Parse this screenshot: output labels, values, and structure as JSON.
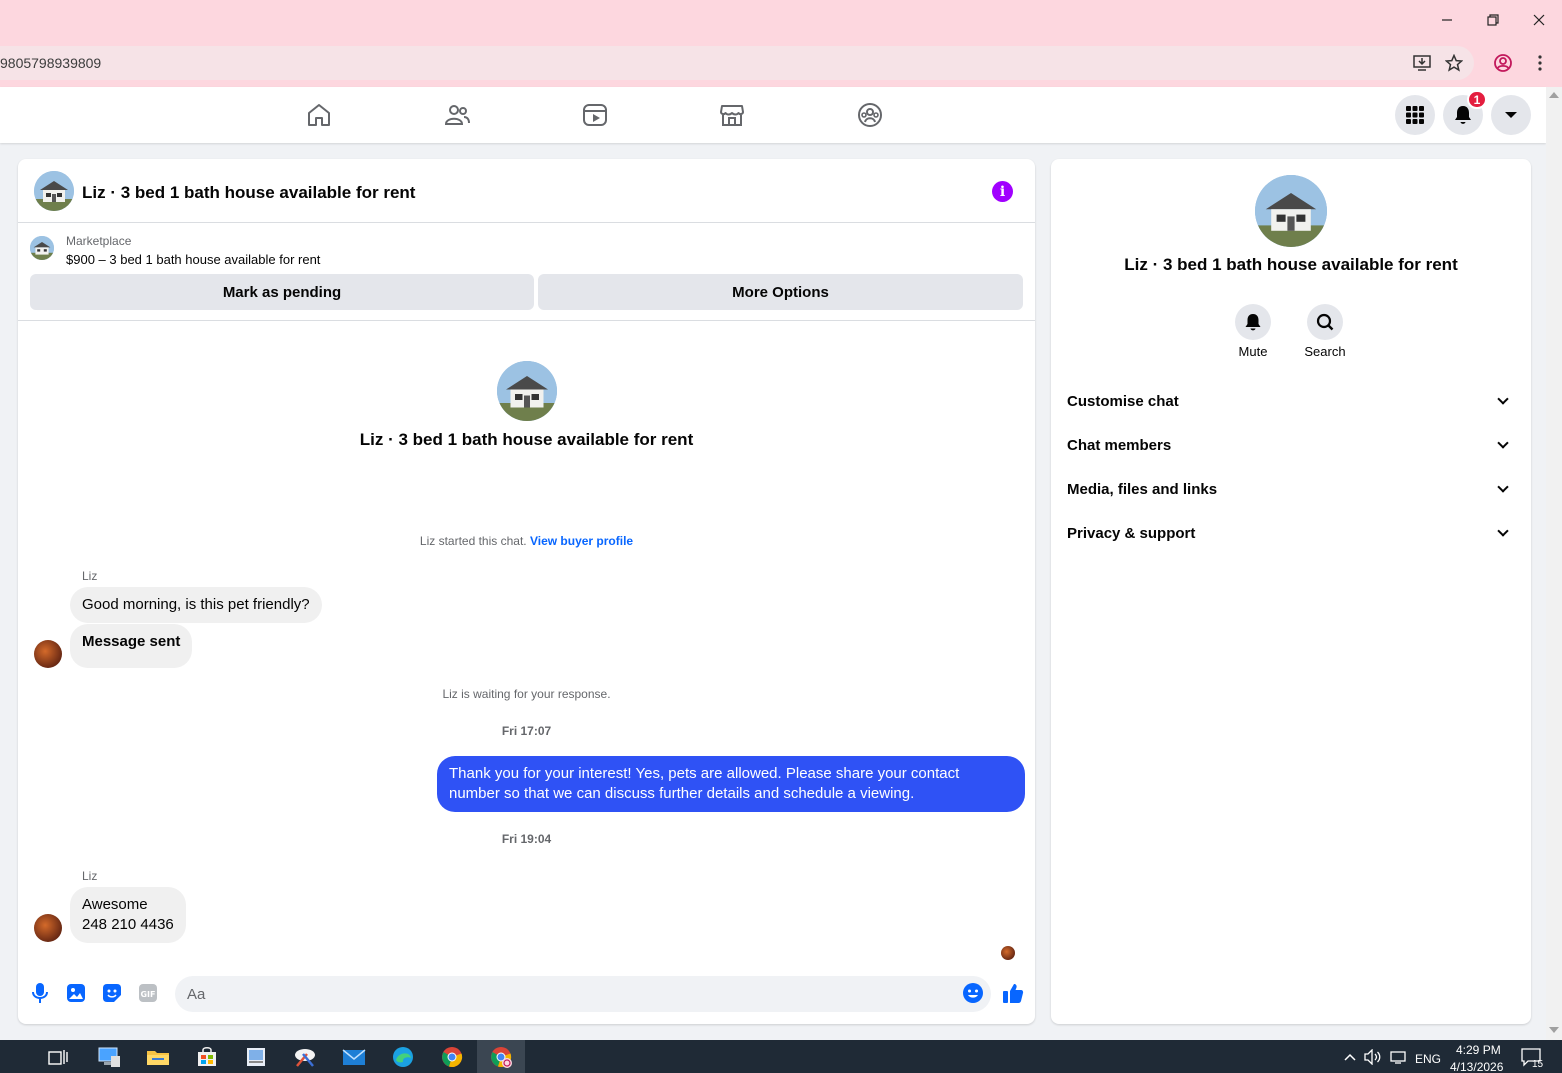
{
  "browser": {
    "url": "9805798939809"
  },
  "nav": {
    "notification_count": "1"
  },
  "chat": {
    "title": "Liz · 3 bed 1 bath house available for rent",
    "marketplace_label": "Marketplace",
    "listing_title": "$900 – 3 bed 1 bath house available for rent",
    "mark_pending_label": "Mark as pending",
    "more_options_label": "More Options",
    "intro_title": "Liz · 3 bed 1 bath house available for rent",
    "started_text": "Liz started this chat.",
    "view_buyer_profile": "View buyer profile",
    "waiting_text": "Liz is waiting for your response.",
    "messages": [
      {
        "sender": "Liz",
        "text": "Good morning, is this pet friendly?"
      },
      {
        "text": "Message sent"
      },
      {
        "time": "Fri 17:07"
      },
      {
        "text": "Thank you for your interest! Yes, pets are allowed. Please share your contact number so that we can discuss further details and schedule a viewing."
      },
      {
        "time": "Fri 19:04"
      },
      {
        "sender": "Liz",
        "line1": "Awesome",
        "line2": "248 210 4436"
      }
    ],
    "input_placeholder": "Aa"
  },
  "info_panel": {
    "title": "Liz · 3 bed 1 bath house available for rent",
    "mute_label": "Mute",
    "search_label": "Search",
    "rows": [
      {
        "label": "Customise chat"
      },
      {
        "label": "Chat members"
      },
      {
        "label": "Media, files and links"
      },
      {
        "label": "Privacy & support"
      }
    ]
  },
  "taskbar": {
    "language": "ENG",
    "time": "4:29 PM",
    "date": "4/13/2026",
    "notifications": "15"
  },
  "colors": {
    "accent": "#0866ff",
    "outgoing_bubble": "#2f52f5",
    "info_icon": "#a100ff",
    "badge": "#e41e3f"
  }
}
